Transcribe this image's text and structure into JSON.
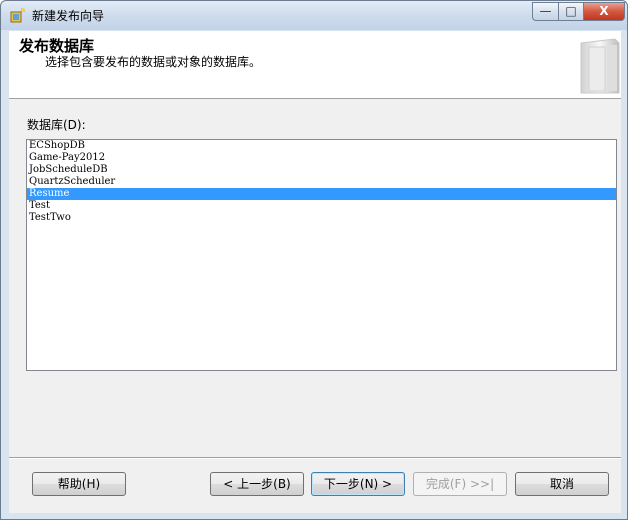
{
  "window": {
    "title": "新建发布向导",
    "minimize_label": "—",
    "maximize_label": "□",
    "close_label": "X"
  },
  "header": {
    "title": "发布数据库",
    "subtitle": "选择包含要发布的数据或对象的数据库。"
  },
  "database_list": {
    "label": "数据库(D):",
    "items": [
      {
        "label": "ECShopDB",
        "selected": false
      },
      {
        "label": "Game-Pay2012",
        "selected": false
      },
      {
        "label": "JobScheduleDB",
        "selected": false
      },
      {
        "label": "QuartzScheduler",
        "selected": false
      },
      {
        "label": "Resume",
        "selected": true
      },
      {
        "label": "Test",
        "selected": false
      },
      {
        "label": "TestTwo",
        "selected": false
      }
    ]
  },
  "buttons": {
    "help": "帮助(H)",
    "back": "< 上一步(B)",
    "next": "下一步(N) >",
    "finish": "完成(F) >>|",
    "cancel": "取消"
  },
  "colors": {
    "selection": "#3399ff",
    "close_button": "#c0371f"
  }
}
